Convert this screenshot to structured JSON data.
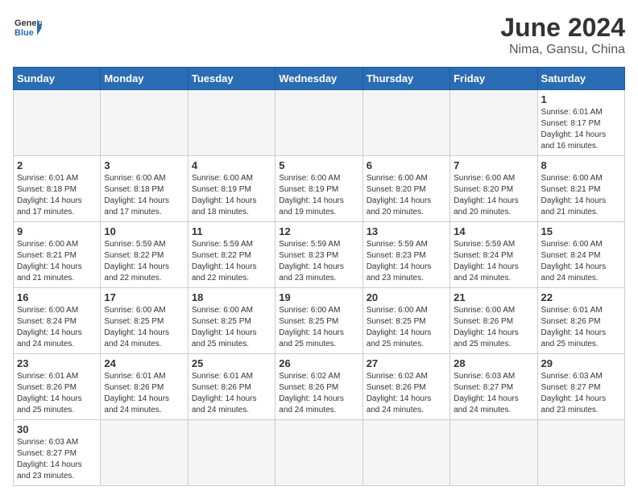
{
  "header": {
    "logo_general": "General",
    "logo_blue": "Blue",
    "month_title": "June 2024",
    "subtitle": "Nima, Gansu, China"
  },
  "weekdays": [
    "Sunday",
    "Monday",
    "Tuesday",
    "Wednesday",
    "Thursday",
    "Friday",
    "Saturday"
  ],
  "weeks": [
    [
      {
        "day": "",
        "info": ""
      },
      {
        "day": "",
        "info": ""
      },
      {
        "day": "",
        "info": ""
      },
      {
        "day": "",
        "info": ""
      },
      {
        "day": "",
        "info": ""
      },
      {
        "day": "",
        "info": ""
      },
      {
        "day": "1",
        "info": "Sunrise: 6:01 AM\nSunset: 8:17 PM\nDaylight: 14 hours\nand 16 minutes."
      }
    ],
    [
      {
        "day": "2",
        "info": "Sunrise: 6:01 AM\nSunset: 8:18 PM\nDaylight: 14 hours\nand 17 minutes."
      },
      {
        "day": "3",
        "info": "Sunrise: 6:00 AM\nSunset: 8:18 PM\nDaylight: 14 hours\nand 17 minutes."
      },
      {
        "day": "4",
        "info": "Sunrise: 6:00 AM\nSunset: 8:19 PM\nDaylight: 14 hours\nand 18 minutes."
      },
      {
        "day": "5",
        "info": "Sunrise: 6:00 AM\nSunset: 8:19 PM\nDaylight: 14 hours\nand 19 minutes."
      },
      {
        "day": "6",
        "info": "Sunrise: 6:00 AM\nSunset: 8:20 PM\nDaylight: 14 hours\nand 20 minutes."
      },
      {
        "day": "7",
        "info": "Sunrise: 6:00 AM\nSunset: 8:20 PM\nDaylight: 14 hours\nand 20 minutes."
      },
      {
        "day": "8",
        "info": "Sunrise: 6:00 AM\nSunset: 8:21 PM\nDaylight: 14 hours\nand 21 minutes."
      }
    ],
    [
      {
        "day": "9",
        "info": "Sunrise: 6:00 AM\nSunset: 8:21 PM\nDaylight: 14 hours\nand 21 minutes."
      },
      {
        "day": "10",
        "info": "Sunrise: 5:59 AM\nSunset: 8:22 PM\nDaylight: 14 hours\nand 22 minutes."
      },
      {
        "day": "11",
        "info": "Sunrise: 5:59 AM\nSunset: 8:22 PM\nDaylight: 14 hours\nand 22 minutes."
      },
      {
        "day": "12",
        "info": "Sunrise: 5:59 AM\nSunset: 8:23 PM\nDaylight: 14 hours\nand 23 minutes."
      },
      {
        "day": "13",
        "info": "Sunrise: 5:59 AM\nSunset: 8:23 PM\nDaylight: 14 hours\nand 23 minutes."
      },
      {
        "day": "14",
        "info": "Sunrise: 5:59 AM\nSunset: 8:24 PM\nDaylight: 14 hours\nand 24 minutes."
      },
      {
        "day": "15",
        "info": "Sunrise: 6:00 AM\nSunset: 8:24 PM\nDaylight: 14 hours\nand 24 minutes."
      }
    ],
    [
      {
        "day": "16",
        "info": "Sunrise: 6:00 AM\nSunset: 8:24 PM\nDaylight: 14 hours\nand 24 minutes."
      },
      {
        "day": "17",
        "info": "Sunrise: 6:00 AM\nSunset: 8:25 PM\nDaylight: 14 hours\nand 24 minutes."
      },
      {
        "day": "18",
        "info": "Sunrise: 6:00 AM\nSunset: 8:25 PM\nDaylight: 14 hours\nand 25 minutes."
      },
      {
        "day": "19",
        "info": "Sunrise: 6:00 AM\nSunset: 8:25 PM\nDaylight: 14 hours\nand 25 minutes."
      },
      {
        "day": "20",
        "info": "Sunrise: 6:00 AM\nSunset: 8:25 PM\nDaylight: 14 hours\nand 25 minutes."
      },
      {
        "day": "21",
        "info": "Sunrise: 6:00 AM\nSunset: 8:26 PM\nDaylight: 14 hours\nand 25 minutes."
      },
      {
        "day": "22",
        "info": "Sunrise: 6:01 AM\nSunset: 8:26 PM\nDaylight: 14 hours\nand 25 minutes."
      }
    ],
    [
      {
        "day": "23",
        "info": "Sunrise: 6:01 AM\nSunset: 8:26 PM\nDaylight: 14 hours\nand 25 minutes."
      },
      {
        "day": "24",
        "info": "Sunrise: 6:01 AM\nSunset: 8:26 PM\nDaylight: 14 hours\nand 24 minutes."
      },
      {
        "day": "25",
        "info": "Sunrise: 6:01 AM\nSunset: 8:26 PM\nDaylight: 14 hours\nand 24 minutes."
      },
      {
        "day": "26",
        "info": "Sunrise: 6:02 AM\nSunset: 8:26 PM\nDaylight: 14 hours\nand 24 minutes."
      },
      {
        "day": "27",
        "info": "Sunrise: 6:02 AM\nSunset: 8:26 PM\nDaylight: 14 hours\nand 24 minutes."
      },
      {
        "day": "28",
        "info": "Sunrise: 6:03 AM\nSunset: 8:27 PM\nDaylight: 14 hours\nand 24 minutes."
      },
      {
        "day": "29",
        "info": "Sunrise: 6:03 AM\nSunset: 8:27 PM\nDaylight: 14 hours\nand 23 minutes."
      }
    ],
    [
      {
        "day": "30",
        "info": "Sunrise: 6:03 AM\nSunset: 8:27 PM\nDaylight: 14 hours\nand 23 minutes."
      },
      {
        "day": "",
        "info": ""
      },
      {
        "day": "",
        "info": ""
      },
      {
        "day": "",
        "info": ""
      },
      {
        "day": "",
        "info": ""
      },
      {
        "day": "",
        "info": ""
      },
      {
        "day": "",
        "info": ""
      }
    ]
  ]
}
